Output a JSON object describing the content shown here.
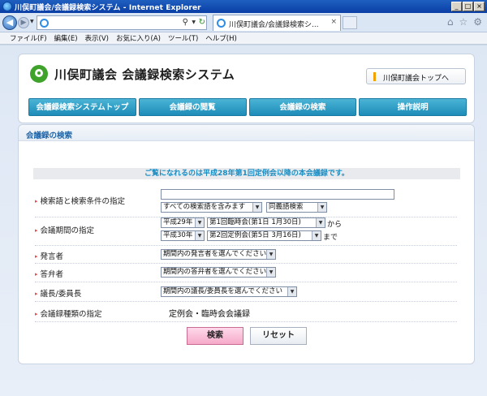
{
  "window": {
    "title": "川俣町議会/会議録検索システム - Internet Explorer",
    "buttons": [
      "_",
      "□",
      "×"
    ]
  },
  "browser": {
    "address_value": "",
    "tab_title": "川俣町議会/会議録検索シ...",
    "icons": [
      "back-icon",
      "forward-icon",
      "search-icon",
      "refresh-icon",
      "home-icon",
      "favorites-star-icon",
      "settings-gear-icon"
    ]
  },
  "menu": [
    "ファイル(F)",
    "編集(E)",
    "表示(V)",
    "お気に入り(A)",
    "ツール(T)",
    "ヘルプ(H)"
  ],
  "header": {
    "site_title": "川俣町議会 会議録検索システム",
    "top_link": "川俣町議会トップへ",
    "tabs": [
      "会議録検索システムトップ",
      "会議録の閲覧",
      "会議録の検索",
      "操作説明"
    ]
  },
  "panel": {
    "title": "会議録の検索",
    "notice": "ご覧になれるのは平成28年第1回定例会以降の本会議録です。"
  },
  "form": {
    "keyword": {
      "label": "検索語と検索条件の指定",
      "value": "",
      "condition_selected": "すべての検索語を含みます",
      "synonym_selected": "同義語検索"
    },
    "period": {
      "label": "会議期間の指定",
      "from_year": "平成29年",
      "from_session": "第1回臨時会(第1日 1月30日)",
      "from_suffix": "から",
      "to_year": "平成30年",
      "to_session": "第2回定例会(第5日 3月16日)",
      "to_suffix": "まで"
    },
    "speaker": {
      "label": "発言者",
      "selected": "期間内の発言者を選んでください"
    },
    "answerer": {
      "label": "答弁者",
      "selected": "期間内の答弁者を選んでください"
    },
    "chair": {
      "label": "議長/委員長",
      "selected": "期間内の議長/委員長を選んでください"
    },
    "record_type": {
      "label": "会議録種類の指定",
      "value": "定例会・臨時会会議録"
    },
    "search_button": "検索",
    "reset_button": "リセット"
  }
}
